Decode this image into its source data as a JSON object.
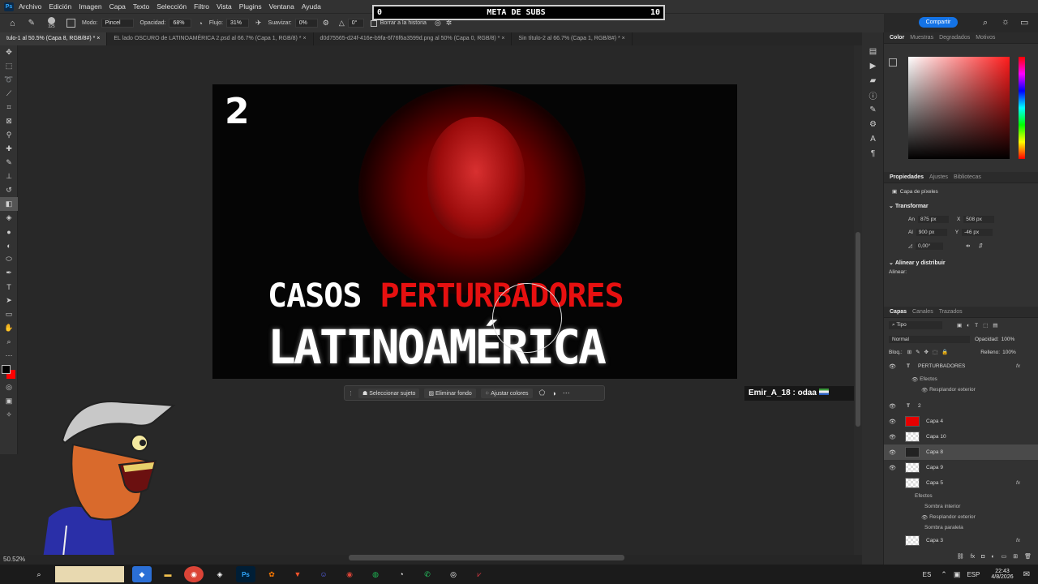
{
  "menubar": {
    "items": [
      "Archivo",
      "Edición",
      "Imagen",
      "Capa",
      "Texto",
      "Selección",
      "Filtro",
      "Vista",
      "Plugins",
      "Ventana",
      "Ayuda"
    ]
  },
  "options": {
    "brush_size": "325",
    "modo_label": "Modo:",
    "modo_value": "Pincel",
    "opacidad_label": "Opacidad:",
    "opacidad_value": "68%",
    "flujo_label": "Flujo:",
    "flujo_value": "31%",
    "suavizar_label": "Suavizar:",
    "suavizar_value": "0%",
    "angle_value": "0°",
    "history_label": "Borrar a la historia",
    "share_label": "Compartir"
  },
  "tabs": [
    "tulo-1 al 50.5% (Capa 8, RGB/8#) *",
    "EL lado OSCURO de LATINOAMÉRICA 2.psd al 66.7% (Capa 1, RGB/8) *",
    "d0d75565-d24f-416e-b9fa-6f76f6a3599d.png al 50% (Capa 0, RGB/8) *",
    "Sin título-2 al 66.7% (Capa 1, RGB/8#) *"
  ],
  "canvas": {
    "number": "2",
    "title_white": "CASOS ",
    "title_red": "PERTURBADORES",
    "subtitle": "LATINOAMÉRICA"
  },
  "context_bar": {
    "select_subject": "Seleccionar sujeto",
    "remove_bg": "Eliminar fondo",
    "adjust_colors": "Ajustar colores"
  },
  "overlay": {
    "subs_left": "0",
    "subs_title": "META DE SUBS",
    "subs_right": "10",
    "chat": "Emir_A_18 : odaa"
  },
  "status": {
    "zoom": "50.52%"
  },
  "color_panel": {
    "tabs": [
      "Color",
      "Muestras",
      "Degradados",
      "Motivos"
    ],
    "fg": "#000000",
    "bg": "#ff0000"
  },
  "properties": {
    "tabs": [
      "Propiedades",
      "Ajustes",
      "Bibliotecas"
    ],
    "pixel_layer": "Capa de píxeles",
    "transform": "Transformar",
    "w_label": "An",
    "w": "875 px",
    "x_label": "X",
    "x": "508 px",
    "h_label": "Al",
    "h": "900 px",
    "y_label": "Y",
    "y": "-46 px",
    "angle": "0,00°",
    "align": "Alinear y distribuir",
    "align_sub": "Alinear:"
  },
  "layers_panel": {
    "tabs": [
      "Capas",
      "Canales",
      "Trazados"
    ],
    "kind": "Tipo",
    "blend": "Normal",
    "opacity_label": "Opacidad:",
    "opacity": "100%",
    "lock_label": "Bloq.:",
    "fill_label": "Relleno:",
    "fill": "100%",
    "layers": [
      {
        "name": "PERTURBADORES",
        "type": "T",
        "fx": "fx"
      },
      {
        "sub": "Efectos"
      },
      {
        "sub": "Resplandor exterior"
      },
      {
        "name": "2",
        "type": "T"
      },
      {
        "name": "Capa 4",
        "type": "red"
      },
      {
        "name": "Capa 10",
        "type": "img"
      },
      {
        "name": "Capa 8",
        "type": "img",
        "selected": true
      },
      {
        "name": "Capa 9",
        "type": "img"
      },
      {
        "name": "Capa 5",
        "type": "img",
        "fx": "fx"
      },
      {
        "sub": "Efectos"
      },
      {
        "sub": "Sombra interior"
      },
      {
        "sub": "Resplandor exterior"
      },
      {
        "sub": "Sombra paralela"
      },
      {
        "name": "Capa 3",
        "type": "img",
        "fx": "fx"
      }
    ]
  },
  "taskbar": {
    "lang": "ES",
    "kb": "ESP",
    "time": "22:43",
    "date": "4/8/2026"
  }
}
